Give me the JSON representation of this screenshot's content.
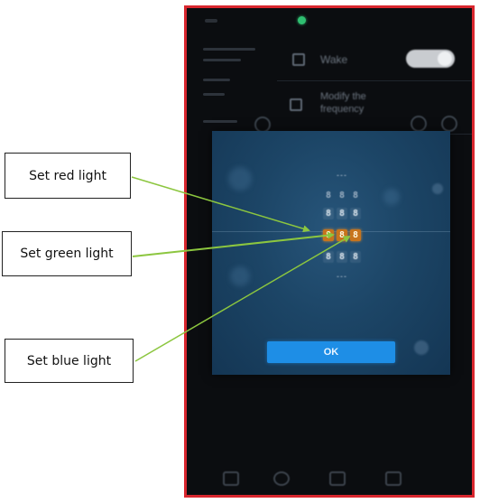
{
  "phone": {
    "settings": {
      "item_1_label": "Wake",
      "item_2_label_line1": "Modify the",
      "item_2_label_line2": "frequency"
    },
    "dialog": {
      "top_label": "---",
      "row_1": [
        "8",
        "8",
        "8"
      ],
      "row_2": [
        "8",
        "8",
        "8"
      ],
      "row_3": [
        "8",
        "8",
        "8"
      ],
      "row_4": [
        "8",
        "8",
        "8"
      ],
      "bottom_label": "---",
      "ok_label": "OK"
    }
  },
  "callouts": {
    "red": "Set red light",
    "green": "Set green light",
    "blue": "Set blue light"
  },
  "colors": {
    "frame_border": "#d8262e",
    "arrow": "#8cc63f",
    "ok_button": "#1e8ee6",
    "active_digit": "#c7741d",
    "dialog_bg": "#1c4566"
  }
}
